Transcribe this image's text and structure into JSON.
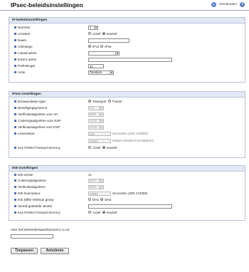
{
  "header": {
    "title": "IPsec-beleidsinstellingen",
    "refresh_label": "Vernieuwen",
    "refresh_icon": "refresh-icon",
    "help_icon": "help-icon"
  },
  "ip_section": {
    "title": "IP-beleidsinstellingen",
    "rows": {
      "number": {
        "label": "Nummer",
        "value": "1"
      },
      "activity": {
        "label": "Activiteit",
        "on": "Actief",
        "off": "Inactief",
        "selected": "off"
      },
      "name": {
        "label": "Naam",
        "value": ""
      },
      "address_type": {
        "label": "Adrestype",
        "opt1": "IPv4",
        "opt2": "IPv6",
        "selected": "opt1"
      },
      "local_address": {
        "label": "Lokaal adres",
        "value": ""
      },
      "remote_address": {
        "label": "Extern adres",
        "value": ""
      },
      "prefix_length": {
        "label": "Prefixlengte",
        "value": "32"
      },
      "action": {
        "label": "Actie",
        "value": "Toestaan"
      }
    }
  },
  "ipsec_section": {
    "title": "IPsec-instellingen",
    "rows": {
      "encapsulation": {
        "label": "Encapsulation-type",
        "opt1": "Transport",
        "opt2": "Tunnel",
        "selected": "opt1"
      },
      "security_protocol": {
        "label": "Beveiligingsprotocol",
        "value": "AH"
      },
      "auth_ah": {
        "label": "Verificatiealgoritme voor AH",
        "value": "MD5"
      },
      "enc_esp": {
        "label": "Coderingsalgoritme voor ESP",
        "value": "Geen"
      },
      "auth_esp": {
        "label": "Verificatiealgoritme voor ESP",
        "value": "Geen"
      },
      "lifetime": {
        "label": "Levensduur",
        "seconds": "600",
        "seconds_unit": "Seconden (300-172800)",
        "kbytes": "16000",
        "kbytes_unit": "Kbytes (20480-2147483647)"
      },
      "pfs": {
        "label": "Key Perfect Forward Secrecy",
        "on": "Actief",
        "off": "Inactief",
        "selected": "off"
      }
    }
  },
  "ike_section": {
    "title": "IKE-instellingen",
    "rows": {
      "ike_version": {
        "label": "IKE-versie",
        "value": "v1"
      },
      "enc_alg": {
        "label": "Coderingsalgoritme",
        "value": "DES"
      },
      "auth_alg": {
        "label": "Verificatiealgoritme",
        "value": "MD5"
      },
      "ike_lifetime": {
        "label": "IKE-levensduur",
        "value": "28800",
        "unit": "Seconden (300-172800)"
      },
      "dh_group": {
        "label": "IKE Diffie-Hellman groep",
        "opt1": "DH1",
        "opt2": "DH2",
        "selected": "opt2"
      },
      "psk": {
        "label": "Vooraf gedeelde sleutel",
        "value": ""
      },
      "pfs": {
        "label": "Key Perfect Forward Secrecy",
        "on": "Actief",
        "off": "Inactief",
        "selected": "off"
      }
    }
  },
  "password": {
    "label": "Voer het beheerderswachtwoord in a.u.b.",
    "value": ""
  },
  "buttons": {
    "apply": "Toepassen",
    "cancel": "Annuleren"
  },
  "colors": {
    "accent": "#4d6fb8",
    "section_header": "#e2e8f4"
  }
}
